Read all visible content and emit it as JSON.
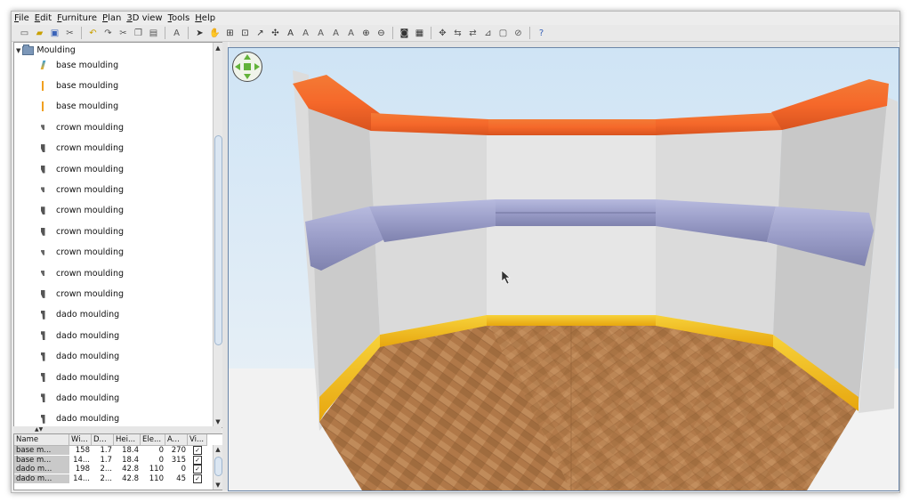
{
  "menu": [
    "File",
    "Edit",
    "Furniture",
    "Plan",
    "3D view",
    "Tools",
    "Help"
  ],
  "toolbar_icons": [
    "new-icon",
    "open-icon",
    "save-icon",
    "cut-prefs-icon",
    "undo-icon",
    "redo-icon",
    "cut-icon",
    "copy-icon",
    "paste-icon",
    "add-furniture-icon",
    "select-icon",
    "pan-icon",
    "create-walls-icon",
    "create-rooms-icon",
    "create-polylines-icon",
    "create-dimensions-icon",
    "add-text-icon",
    "text-style-icon",
    "bold-icon",
    "italic-icon",
    "increase-text-icon",
    "decrease-text-icon",
    "zoom-in-icon",
    "zoom-out-icon",
    "photo-icon",
    "video-icon",
    "toggle-1-icon",
    "toggle-2-icon",
    "toggle-3-icon",
    "toggle-4-icon",
    "toggle-5-icon",
    "toggle-6-icon",
    "help-icon"
  ],
  "tree": {
    "root_label": "Moulding",
    "items": [
      {
        "label": "base moulding",
        "icon": "base-b"
      },
      {
        "label": "base moulding",
        "icon": "base"
      },
      {
        "label": "base moulding",
        "icon": "base"
      },
      {
        "label": "crown moulding",
        "icon": "crown"
      },
      {
        "label": "crown moulding",
        "icon": "crown-l"
      },
      {
        "label": "crown moulding",
        "icon": "crown-l"
      },
      {
        "label": "crown moulding",
        "icon": "crown"
      },
      {
        "label": "crown moulding",
        "icon": "crown-l"
      },
      {
        "label": "crown moulding",
        "icon": "crown-l"
      },
      {
        "label": "crown moulding",
        "icon": "crown"
      },
      {
        "label": "crown moulding",
        "icon": "crown"
      },
      {
        "label": "crown moulding",
        "icon": "crown-l"
      },
      {
        "label": "dado moulding",
        "icon": "dado"
      },
      {
        "label": "dado moulding",
        "icon": "dado"
      },
      {
        "label": "dado moulding",
        "icon": "dado"
      },
      {
        "label": "dado moulding",
        "icon": "dado"
      },
      {
        "label": "dado moulding",
        "icon": "dado"
      },
      {
        "label": "dado moulding",
        "icon": "dado"
      }
    ]
  },
  "table": {
    "headers": [
      "Name",
      "Wi...",
      "D...",
      "Hei...",
      "Ele...",
      "A...",
      "Vi..."
    ],
    "rows": [
      [
        "base m...",
        "158",
        "1.7",
        "18.4",
        "0",
        "270",
        "✓"
      ],
      [
        "base m...",
        "14...",
        "1.7",
        "18.4",
        "0",
        "315",
        "✓"
      ],
      [
        "dado m...",
        "198",
        "2...",
        "42.8",
        "110",
        "0",
        "✓"
      ],
      [
        "dado m...",
        "14...",
        "2...",
        "42.8",
        "110",
        "45",
        "✓"
      ]
    ]
  },
  "colors": {
    "crown_moulding": "#f06a28",
    "chair_rail": "#a6a9d2",
    "baseboard": "#f2c21a",
    "wall": "#e2e2e2",
    "sky": "#cfe3f3",
    "floor": "#b27a4a"
  }
}
